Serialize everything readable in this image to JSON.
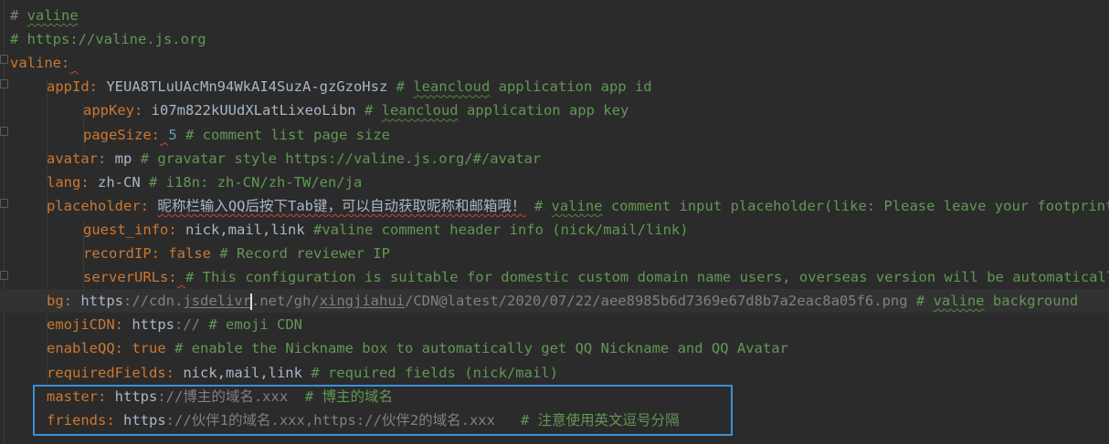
{
  "editor": {
    "lines": [
      {
        "indent": 0,
        "parts": [
          {
            "t": "# ",
            "c": "hash"
          },
          {
            "t": "valine",
            "c": "cmt squig-green"
          }
        ]
      },
      {
        "indent": 0,
        "parts": [
          {
            "t": "# https://valine.js.org",
            "c": "cmt"
          }
        ]
      },
      {
        "indent": 0,
        "parts": [
          {
            "t": "valine",
            "c": "key"
          },
          {
            "t": ":",
            "c": "key"
          },
          {
            "t": " ",
            "c": "val squig"
          }
        ]
      },
      {
        "indent": 1,
        "parts": [
          {
            "t": "appId",
            "c": "key"
          },
          {
            "t": ": ",
            "c": "key"
          },
          {
            "t": "YEUA8TLuUAcMn94WkAI4SuzA-gzGzoHsz ",
            "c": "val"
          },
          {
            "t": "# ",
            "c": "cmt"
          },
          {
            "t": "leancloud",
            "c": "cmt squig-green"
          },
          {
            "t": " application app id",
            "c": "cmt"
          }
        ]
      },
      {
        "indent": 2,
        "parts": [
          {
            "t": "appKey",
            "c": "key"
          },
          {
            "t": ": ",
            "c": "key"
          },
          {
            "t": "i07m822kUUdXLatLixeoLibn ",
            "c": "val"
          },
          {
            "t": "# ",
            "c": "cmt"
          },
          {
            "t": "leancloud",
            "c": "cmt squig-green"
          },
          {
            "t": " application app key",
            "c": "cmt"
          }
        ]
      },
      {
        "indent": 2,
        "parts": [
          {
            "t": "pageSize",
            "c": "key"
          },
          {
            "t": ":",
            "c": "key"
          },
          {
            "t": " ",
            "c": "val squig"
          },
          {
            "t": "5",
            "c": "num"
          },
          {
            "t": " # comment list page size",
            "c": "cmt"
          }
        ]
      },
      {
        "indent": 1,
        "parts": [
          {
            "t": "avatar",
            "c": "key"
          },
          {
            "t": ": ",
            "c": "key"
          },
          {
            "t": "mp ",
            "c": "val"
          },
          {
            "t": "# gravatar style https://valine.js.org/#/avatar",
            "c": "cmt"
          }
        ]
      },
      {
        "indent": 1,
        "parts": [
          {
            "t": "lang",
            "c": "key"
          },
          {
            "t": ": ",
            "c": "key"
          },
          {
            "t": "zh-CN ",
            "c": "val"
          },
          {
            "t": "# i18n: zh-CN/zh-TW/en/ja",
            "c": "cmt"
          }
        ]
      },
      {
        "indent": 1,
        "parts": [
          {
            "t": "placeholder",
            "c": "key"
          },
          {
            "t": ": ",
            "c": "key"
          },
          {
            "t": "昵称栏输入QQ后按下Tab键，可以自动获取昵称和邮箱哦！",
            "c": "val squig"
          },
          {
            "t": " ",
            "c": "val"
          },
          {
            "t": "# ",
            "c": "cmt"
          },
          {
            "t": "valine",
            "c": "cmt squig-green"
          },
          {
            "t": " comment input placeholder(like: Please leave your footprints)",
            "c": "cmt"
          }
        ]
      },
      {
        "indent": 2,
        "parts": [
          {
            "t": "guest_info",
            "c": "key"
          },
          {
            "t": ": ",
            "c": "key"
          },
          {
            "t": "nick,mail,link ",
            "c": "val"
          },
          {
            "t": "#valine comment header info (nick/mail/link)",
            "c": "cmt"
          }
        ]
      },
      {
        "indent": 2,
        "parts": [
          {
            "t": "recordIP",
            "c": "key"
          },
          {
            "t": ": ",
            "c": "key"
          },
          {
            "t": "false ",
            "c": "key"
          },
          {
            "t": "# Record reviewer IP",
            "c": "cmt"
          }
        ]
      },
      {
        "indent": 2,
        "parts": [
          {
            "t": "serverURLs",
            "c": "key"
          },
          {
            "t": ":",
            "c": "key"
          },
          {
            "t": " ",
            "c": "val squig"
          },
          {
            "t": "# This configuration is suitable for domestic custom domain name users, overseas version will be automatically detected",
            "c": "cmt"
          }
        ]
      },
      {
        "indent": 1,
        "current": true,
        "parts": [
          {
            "t": "bg",
            "c": "key"
          },
          {
            "t": ": ",
            "c": "key"
          },
          {
            "t": "https",
            "c": "val"
          },
          {
            "t": "://cdn.",
            "c": "hash"
          },
          {
            "t": "jsdelivr",
            "c": "hash url-link"
          },
          {
            "t": ".",
            "c": "caret-marker"
          },
          {
            "t": "net/gh/",
            "c": "hash"
          },
          {
            "t": "xingjiahui",
            "c": "hash url-link"
          },
          {
            "t": "/CDN@latest/2020/07/22/aee8985b6d7369e67d8b7a2eac8a05f6.png ",
            "c": "hash"
          },
          {
            "t": "# ",
            "c": "cmt"
          },
          {
            "t": "valine",
            "c": "cmt squig-green"
          },
          {
            "t": " background",
            "c": "cmt"
          }
        ]
      },
      {
        "indent": 1,
        "parts": [
          {
            "t": "emojiCDN",
            "c": "key"
          },
          {
            "t": ": ",
            "c": "key"
          },
          {
            "t": "https",
            "c": "val"
          },
          {
            "t": ":// ",
            "c": "hash"
          },
          {
            "t": "# emoji CDN",
            "c": "cmt"
          }
        ]
      },
      {
        "indent": 1,
        "parts": [
          {
            "t": "enableQQ",
            "c": "key"
          },
          {
            "t": ": ",
            "c": "key"
          },
          {
            "t": "true ",
            "c": "key"
          },
          {
            "t": "# enable the Nickname box to automatically get QQ Nickname and QQ Avatar",
            "c": "cmt"
          }
        ]
      },
      {
        "indent": 1,
        "parts": [
          {
            "t": "requiredFields",
            "c": "key"
          },
          {
            "t": ": ",
            "c": "key"
          },
          {
            "t": "nick,mail,link ",
            "c": "val"
          },
          {
            "t": "# required fields (nick/mail)",
            "c": "cmt"
          }
        ]
      },
      {
        "indent": 1,
        "parts": [
          {
            "t": "master",
            "c": "key"
          },
          {
            "t": ": ",
            "c": "key"
          },
          {
            "t": "https",
            "c": "val"
          },
          {
            "t": "://博主的域名.xxx  ",
            "c": "hash"
          },
          {
            "t": "# 博主的域名",
            "c": "cmt"
          }
        ]
      },
      {
        "indent": 1,
        "parts": [
          {
            "t": "friends",
            "c": "key"
          },
          {
            "t": ": ",
            "c": "key"
          },
          {
            "t": "https",
            "c": "val"
          },
          {
            "t": "://伙伴1的域名.xxx,https://伙伴2的域名.xxx   ",
            "c": "hash"
          },
          {
            "t": "# 注意使用英文逗号分隔",
            "c": "cmt"
          }
        ]
      }
    ]
  }
}
